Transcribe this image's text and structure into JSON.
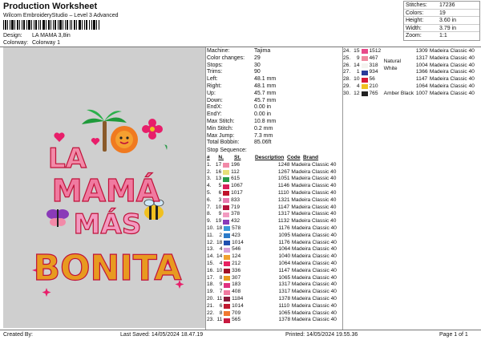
{
  "header": {
    "title": "Production Worksheet",
    "subtitle": "Wilcom EmbroideryStudio – Level 3 Advanced",
    "design_label": "Design:",
    "design_value": "LA MAMA 3,8in",
    "colorway_label": "Colorway:",
    "colorway_value": "Colorway 1"
  },
  "stats": [
    {
      "k": "Stitches:",
      "v": "17236"
    },
    {
      "k": "Colors:",
      "v": "19"
    },
    {
      "k": "Height:",
      "v": "3.60 in"
    },
    {
      "k": "Width:",
      "v": "3.79 in"
    },
    {
      "k": "Zoom:",
      "v": "1:1"
    }
  ],
  "params": [
    {
      "k": "Machine:",
      "v": "Tajima"
    },
    {
      "k": "Color changes:",
      "v": "29"
    },
    {
      "k": "Stops:",
      "v": "30"
    },
    {
      "k": "Trims:",
      "v": "90"
    },
    {
      "k": "Left:",
      "v": "48.1 mm"
    },
    {
      "k": "Right:",
      "v": "48.1 mm"
    },
    {
      "k": "Up:",
      "v": "45.7 mm"
    },
    {
      "k": "Down:",
      "v": "45.7 mm"
    },
    {
      "k": "EndX:",
      "v": "0.00 in"
    },
    {
      "k": "EndY:",
      "v": "0.00 in"
    },
    {
      "k": "Max Stitch:",
      "v": "10.8 mm"
    },
    {
      "k": "Min Stitch:",
      "v": "0.2 mm"
    },
    {
      "k": "Max Jump:",
      "v": "7.3 mm"
    },
    {
      "k": "Total Bobbin:",
      "v": "85.06ft"
    }
  ],
  "sequence_title": "Stop Sequence:",
  "seq_headers": {
    "no": "#",
    "n": "N.",
    "st": "St.",
    "desc": "Description",
    "code": "Code",
    "brand": "Brand"
  },
  "sequence_left": [
    {
      "no": "1.",
      "n": "17",
      "color": "#f28aa8",
      "st": "196",
      "desc": "",
      "code": "1248",
      "brand": "Madeira Classic 40"
    },
    {
      "no": "2.",
      "n": "16",
      "color": "#e8e07a",
      "st": "112",
      "desc": "",
      "code": "1267",
      "brand": "Madeira Classic 40"
    },
    {
      "no": "3.",
      "n": "13",
      "color": "#2a9a4a",
      "st": "615",
      "desc": "",
      "code": "1051",
      "brand": "Madeira Classic 40"
    },
    {
      "no": "4.",
      "n": "5",
      "color": "#d81e5b",
      "st": "1067",
      "desc": "",
      "code": "1146",
      "brand": "Madeira Classic 40"
    },
    {
      "no": "5.",
      "n": "6",
      "color": "#c0122a",
      "st": "1017",
      "desc": "",
      "code": "1110",
      "brand": "Madeira Classic 40"
    },
    {
      "no": "6.",
      "n": "3",
      "color": "#e87ab0",
      "st": "833",
      "desc": "",
      "code": "1321",
      "brand": "Madeira Classic 40"
    },
    {
      "no": "7.",
      "n": "10",
      "color": "#b5123a",
      "st": "719",
      "desc": "",
      "code": "1147",
      "brand": "Madeira Classic 40"
    },
    {
      "no": "8.",
      "n": "9",
      "color": "#f29ac0",
      "st": "378",
      "desc": "",
      "code": "1317",
      "brand": "Madeira Classic 40"
    },
    {
      "no": "9.",
      "n": "19",
      "color": "#8a3ab8",
      "st": "432",
      "desc": "",
      "code": "1132",
      "brand": "Madeira Classic 40"
    },
    {
      "no": "10.",
      "n": "18",
      "color": "#3a9ad8",
      "st": "578",
      "desc": "",
      "code": "1176",
      "brand": "Madeira Classic 40"
    },
    {
      "no": "11.",
      "n": "2",
      "color": "#2a7ac8",
      "st": "423",
      "desc": "",
      "code": "1095",
      "brand": "Madeira Classic 40"
    },
    {
      "no": "12.",
      "n": "18",
      "color": "#2050b0",
      "st": "1014",
      "desc": "",
      "code": "1176",
      "brand": "Madeira Classic 40"
    },
    {
      "no": "13.",
      "n": "4",
      "color": "#d8a0d8",
      "st": "546",
      "desc": "",
      "code": "1064",
      "brand": "Madeira Classic 40"
    },
    {
      "no": "14.",
      "n": "14",
      "color": "#f0a030",
      "st": "124",
      "desc": "",
      "code": "1040",
      "brand": "Madeira Classic 40"
    },
    {
      "no": "15.",
      "n": "4",
      "color": "#e82060",
      "st": "212",
      "desc": "",
      "code": "1064",
      "brand": "Madeira Classic 40"
    },
    {
      "no": "16.",
      "n": "10",
      "color": "#a01028",
      "st": "336",
      "desc": "",
      "code": "1147",
      "brand": "Madeira Classic 40"
    },
    {
      "no": "17.",
      "n": "8",
      "color": "#e89a20",
      "st": "307",
      "desc": "",
      "code": "1065",
      "brand": "Madeira Classic 40"
    },
    {
      "no": "18.",
      "n": "9",
      "color": "#e03080",
      "st": "183",
      "desc": "",
      "code": "1317",
      "brand": "Madeira Classic 40"
    },
    {
      "no": "19.",
      "n": "7",
      "color": "#f07aa0",
      "st": "408",
      "desc": "",
      "code": "1317",
      "brand": "Madeira Classic 40"
    },
    {
      "no": "20.",
      "n": "11",
      "color": "#8a1a3a",
      "st": "1184",
      "desc": "",
      "code": "1378",
      "brand": "Madeira Classic 40"
    },
    {
      "no": "21.",
      "n": "6",
      "color": "#c01a30",
      "st": "1014",
      "desc": "",
      "code": "1110",
      "brand": "Madeira Classic 40"
    },
    {
      "no": "22.",
      "n": "8",
      "color": "#f07830",
      "st": "709",
      "desc": "",
      "code": "1065",
      "brand": "Madeira Classic 40"
    },
    {
      "no": "23.",
      "n": "11",
      "color": "#c81a40",
      "st": "565",
      "desc": "",
      "code": "1378",
      "brand": "Madeira Classic 40"
    }
  ],
  "sequence_right": [
    {
      "no": "24.",
      "n": "15",
      "color": "#e84a8a",
      "st": "1512",
      "desc": "",
      "code": "1309",
      "brand": "Madeira Classic 40"
    },
    {
      "no": "25.",
      "n": "9",
      "color": "#f08aa0",
      "st": "467",
      "desc": "",
      "code": "1317",
      "brand": "Madeira Classic 40"
    },
    {
      "no": "26.",
      "n": "14",
      "color": "#f4f4f0",
      "st": "318",
      "desc": "Natural White",
      "code": "1004",
      "brand": "Madeira Classic 40"
    },
    {
      "no": "27.",
      "n": "1",
      "color": "#2a3a9a",
      "st": "934",
      "desc": "",
      "code": "1366",
      "brand": "Madeira Classic 40"
    },
    {
      "no": "28.",
      "n": "10",
      "color": "#d81a3a",
      "st": "56",
      "desc": "",
      "code": "1147",
      "brand": "Madeira Classic 40"
    },
    {
      "no": "29.",
      "n": "4",
      "color": "#f0c020",
      "st": "210",
      "desc": "",
      "code": "1064",
      "brand": "Madeira Classic 40"
    },
    {
      "no": "30.",
      "n": "12",
      "color": "#222222",
      "st": "765",
      "desc": "Amber Black",
      "code": "1007",
      "brand": "Madeira Classic 40"
    }
  ],
  "footer": {
    "created": "Created By:",
    "saved": "Last Saved: 14/05/2024 18.47.19",
    "printed": "Printed: 14/05/2024 19.55.36",
    "page": "Page 1 of 1"
  },
  "artwork": {
    "line1": "LA",
    "line2": "MAMÁ",
    "line3": "MÁS",
    "line4": "BONITA"
  }
}
